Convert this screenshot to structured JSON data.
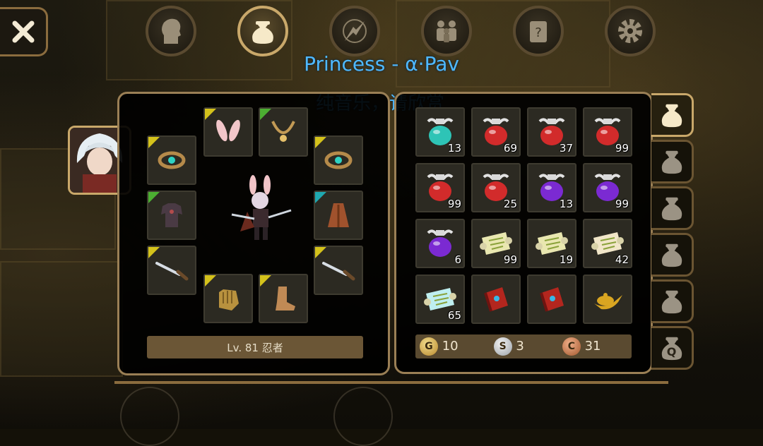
{
  "top_tabs": [
    {
      "icon": "character-head-icon",
      "active": false
    },
    {
      "icon": "inventory-bag-icon",
      "active": true
    },
    {
      "icon": "skill-compass-icon",
      "active": false
    },
    {
      "icon": "party-people-icon",
      "active": false
    },
    {
      "icon": "quest-scroll-icon",
      "active": false
    },
    {
      "icon": "settings-gear-icon",
      "active": false
    }
  ],
  "overlay": {
    "line1": "Princess - α·Pav",
    "line2": "纯音乐，请欣赏"
  },
  "equipment": {
    "level_label": "Lv. 81 忍者",
    "slots": [
      {
        "name": "bunny-ears-slot",
        "item": "bunny-ears",
        "grade": "yellow"
      },
      {
        "name": "necklace-slot",
        "item": "necklace",
        "grade": "green"
      },
      {
        "name": "left-ring-slot",
        "item": "ring",
        "grade": "yellow"
      },
      {
        "name": "right-ring-slot",
        "item": "ring",
        "grade": "yellow"
      },
      {
        "name": "armor-slot",
        "item": "dark-armor",
        "grade": "green"
      },
      {
        "name": "cloak-slot",
        "item": "cloak",
        "grade": "cyan"
      },
      {
        "name": "left-weapon-slot",
        "item": "dagger",
        "grade": "yellow"
      },
      {
        "name": "right-weapon-slot",
        "item": "dagger",
        "grade": "yellow"
      },
      {
        "name": "gloves-slot",
        "item": "gloves",
        "grade": "yellow"
      },
      {
        "name": "boots-slot",
        "item": "boots",
        "grade": "yellow"
      }
    ]
  },
  "inventory": {
    "items": [
      {
        "name": "cyan-potion",
        "count": "13",
        "color": "#2ec4b6"
      },
      {
        "name": "red-potion-large",
        "count": "69",
        "color": "#d22b2b"
      },
      {
        "name": "red-potion-large",
        "count": "37",
        "color": "#d22b2b"
      },
      {
        "name": "red-potion-small",
        "count": "99",
        "color": "#d22b2b"
      },
      {
        "name": "red-potion-small",
        "count": "99",
        "color": "#d22b2b"
      },
      {
        "name": "red-potion-small",
        "count": "25",
        "color": "#d22b2b"
      },
      {
        "name": "purple-potion-large",
        "count": "13",
        "color": "#7b2ad2"
      },
      {
        "name": "purple-potion-small",
        "count": "99",
        "color": "#7b2ad2"
      },
      {
        "name": "purple-potion-small",
        "count": "6",
        "color": "#7b2ad2"
      },
      {
        "name": "scroll-yellow",
        "count": "99",
        "color": "#e9e7b0"
      },
      {
        "name": "scroll-yellow",
        "count": "19",
        "color": "#e9e7b0"
      },
      {
        "name": "scroll-map",
        "count": "42",
        "color": "#f1e6c8"
      },
      {
        "name": "scroll-cyan",
        "count": "65",
        "color": "#bfeff0"
      },
      {
        "name": "red-book",
        "count": "",
        "color": "#b3261e"
      },
      {
        "name": "red-book",
        "count": "",
        "color": "#b3261e"
      },
      {
        "name": "magic-lamp",
        "count": "",
        "color": "#d9a521"
      }
    ],
    "currency": {
      "gold": "10",
      "silver": "3",
      "copper": "31"
    },
    "currency_symbols": {
      "gold": "G",
      "silver": "S",
      "copper": "C"
    }
  },
  "side_tabs": [
    {
      "label": "",
      "active": true
    },
    {
      "label": "",
      "active": false
    },
    {
      "label": "",
      "active": false
    },
    {
      "label": "",
      "active": false
    },
    {
      "label": "",
      "active": false
    },
    {
      "label": "Q",
      "active": false
    }
  ],
  "colors": {
    "frame": "#9a7f55",
    "grade_yellow": "#d4c21b",
    "grade_green": "#4caf32",
    "grade_cyan": "#1fa8b0"
  }
}
